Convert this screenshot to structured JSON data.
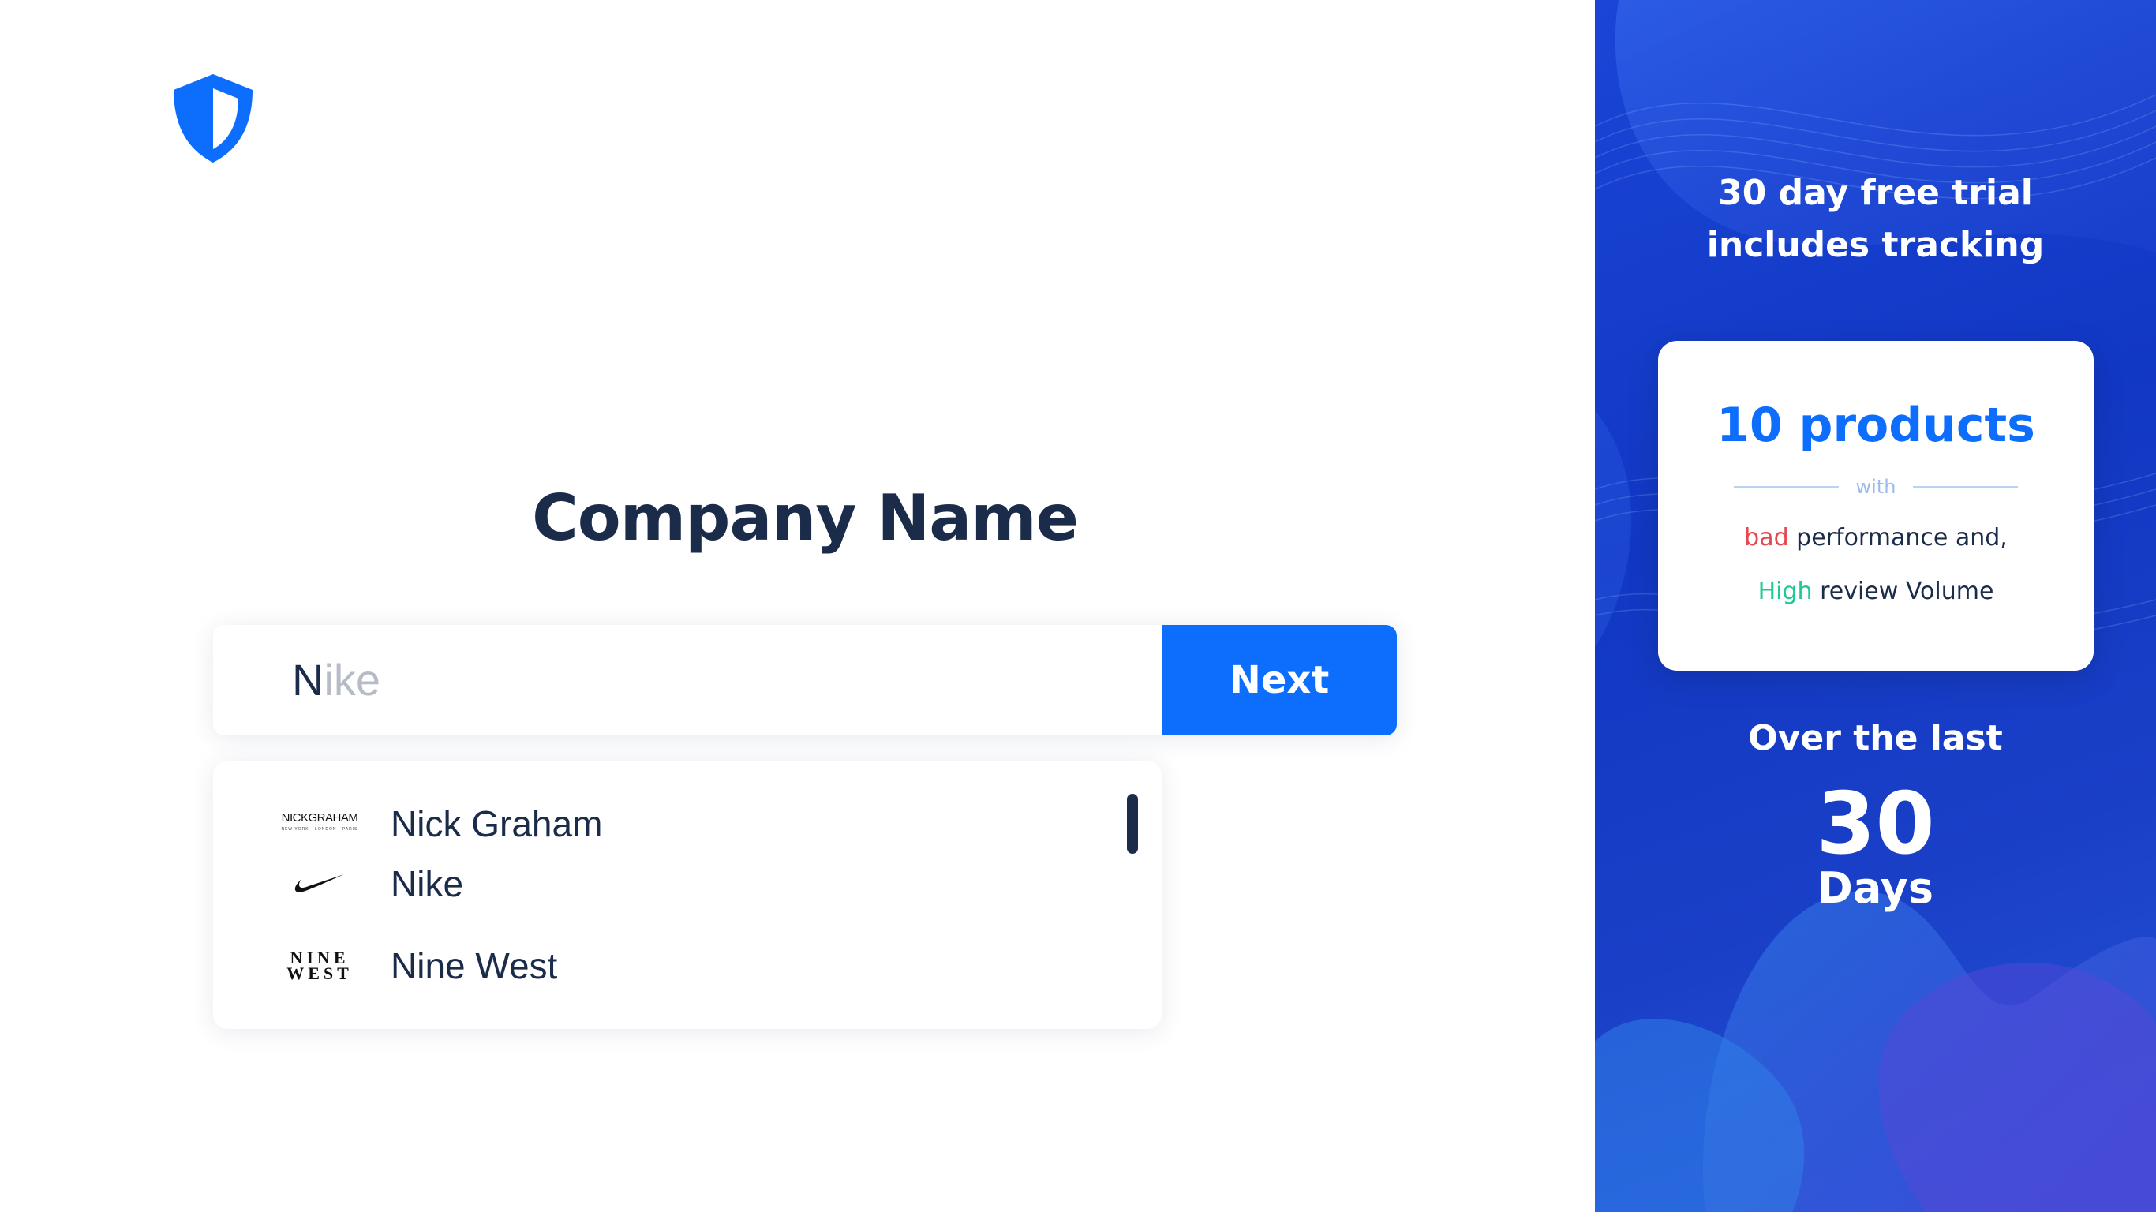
{
  "form": {
    "title": "Company Name",
    "search": {
      "typed": "N",
      "suggestion_rest": "ike",
      "placeholder": ""
    },
    "next_label": "Next",
    "suggestions": [
      {
        "label": "Nick Graham",
        "logo_text": "NICKGRAHAM",
        "logo_subtext": "NEW YORK · LONDON · PARIS"
      },
      {
        "label": "Nike",
        "logo_icon": "swoosh-icon"
      },
      {
        "label": "Nine West",
        "logo_text_top": "NINE",
        "logo_text_bottom": "WEST"
      }
    ]
  },
  "promo": {
    "title": "30 day free trial includes tracking",
    "card": {
      "headline": "10 products",
      "divider_text": "with",
      "line1_highlight": "bad",
      "line1_rest": " performance and,",
      "line2_highlight": "High",
      "line2_rest": " review Volume"
    },
    "over_label": "Over the last",
    "days_number": "30",
    "days_label": "Days"
  },
  "colors": {
    "accent": "#0d6efd",
    "navy": "#1b2c4a",
    "panel": "#1138c4",
    "bad": "#e5484d",
    "high": "#1fc996"
  },
  "icons": {
    "logo": "shield-icon"
  }
}
